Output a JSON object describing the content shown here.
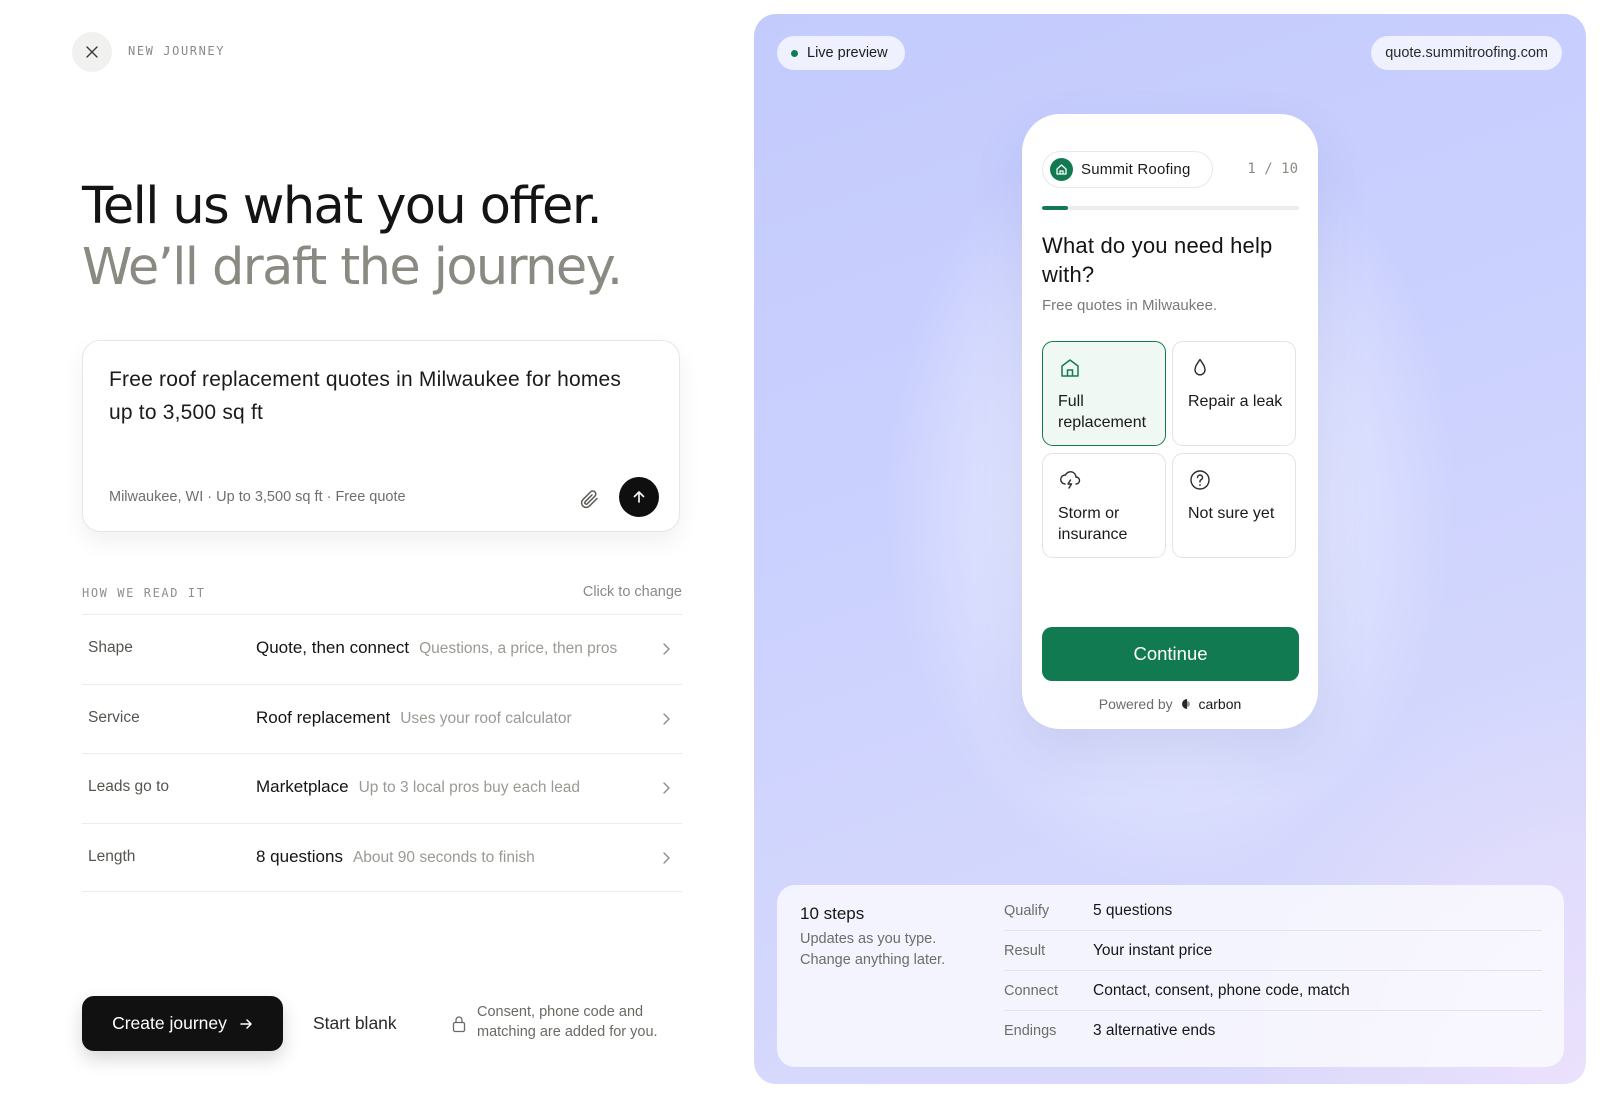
{
  "header": {
    "crumb": "NEW JOURNEY"
  },
  "headline": {
    "main": "Tell us what you offer.",
    "muted": "We’ll draft the journey."
  },
  "prompt": {
    "text": "Free roof replacement quotes in Milwaukee for homes up to 3,500 sq ft",
    "meta": "Milwaukee, WI · Up to 3,500 sq ft · Free quote"
  },
  "reading": {
    "label": "HOW WE READ IT",
    "change": "Click to change",
    "rows": [
      {
        "key": "Shape",
        "value": "Quote, then connect",
        "detail": "Questions, a price, then pros"
      },
      {
        "key": "Service",
        "value": "Roof replacement",
        "detail": "Uses your roof calculator"
      },
      {
        "key": "Leads go to",
        "value": "Marketplace",
        "detail": "Up to 3 local pros buy each lead"
      },
      {
        "key": "Length",
        "value": "8 questions",
        "detail": "About 90 seconds to finish"
      }
    ]
  },
  "actions": {
    "create": "Create journey",
    "blank": "Start blank",
    "consent": "Consent, phone code and matching are added for you."
  },
  "preview": {
    "live": "Live preview",
    "url": "quote.summitroofing.com",
    "brand": "Summit Roofing",
    "step": "1 / 10",
    "progress": 0.1,
    "question": "What do you need help with?",
    "sub": "Free quotes in Milwaukee.",
    "options": [
      {
        "label": "Full replacement",
        "icon": "house-icon",
        "selected": true
      },
      {
        "label": "Repair a leak",
        "icon": "droplet-icon",
        "selected": false
      },
      {
        "label": "Storm or insurance",
        "icon": "storm-cloud-icon",
        "selected": false
      },
      {
        "label": "Not sure yet",
        "icon": "question-circle-icon",
        "selected": false
      }
    ],
    "continue": "Continue",
    "powered_by": "Powered by",
    "powered_brand": "carbon"
  },
  "summary": {
    "title": "10 steps",
    "sub": "Updates as you type. Change anything later.",
    "rows": [
      {
        "key": "Qualify",
        "value": "5 questions"
      },
      {
        "key": "Result",
        "value": "Your instant price"
      },
      {
        "key": "Connect",
        "value": "Contact, consent, phone code, match"
      },
      {
        "key": "Endings",
        "value": "3 alternative ends"
      }
    ]
  },
  "colors": {
    "accent": "#127a51",
    "ink": "#111111",
    "muted": "#8b8a82"
  }
}
